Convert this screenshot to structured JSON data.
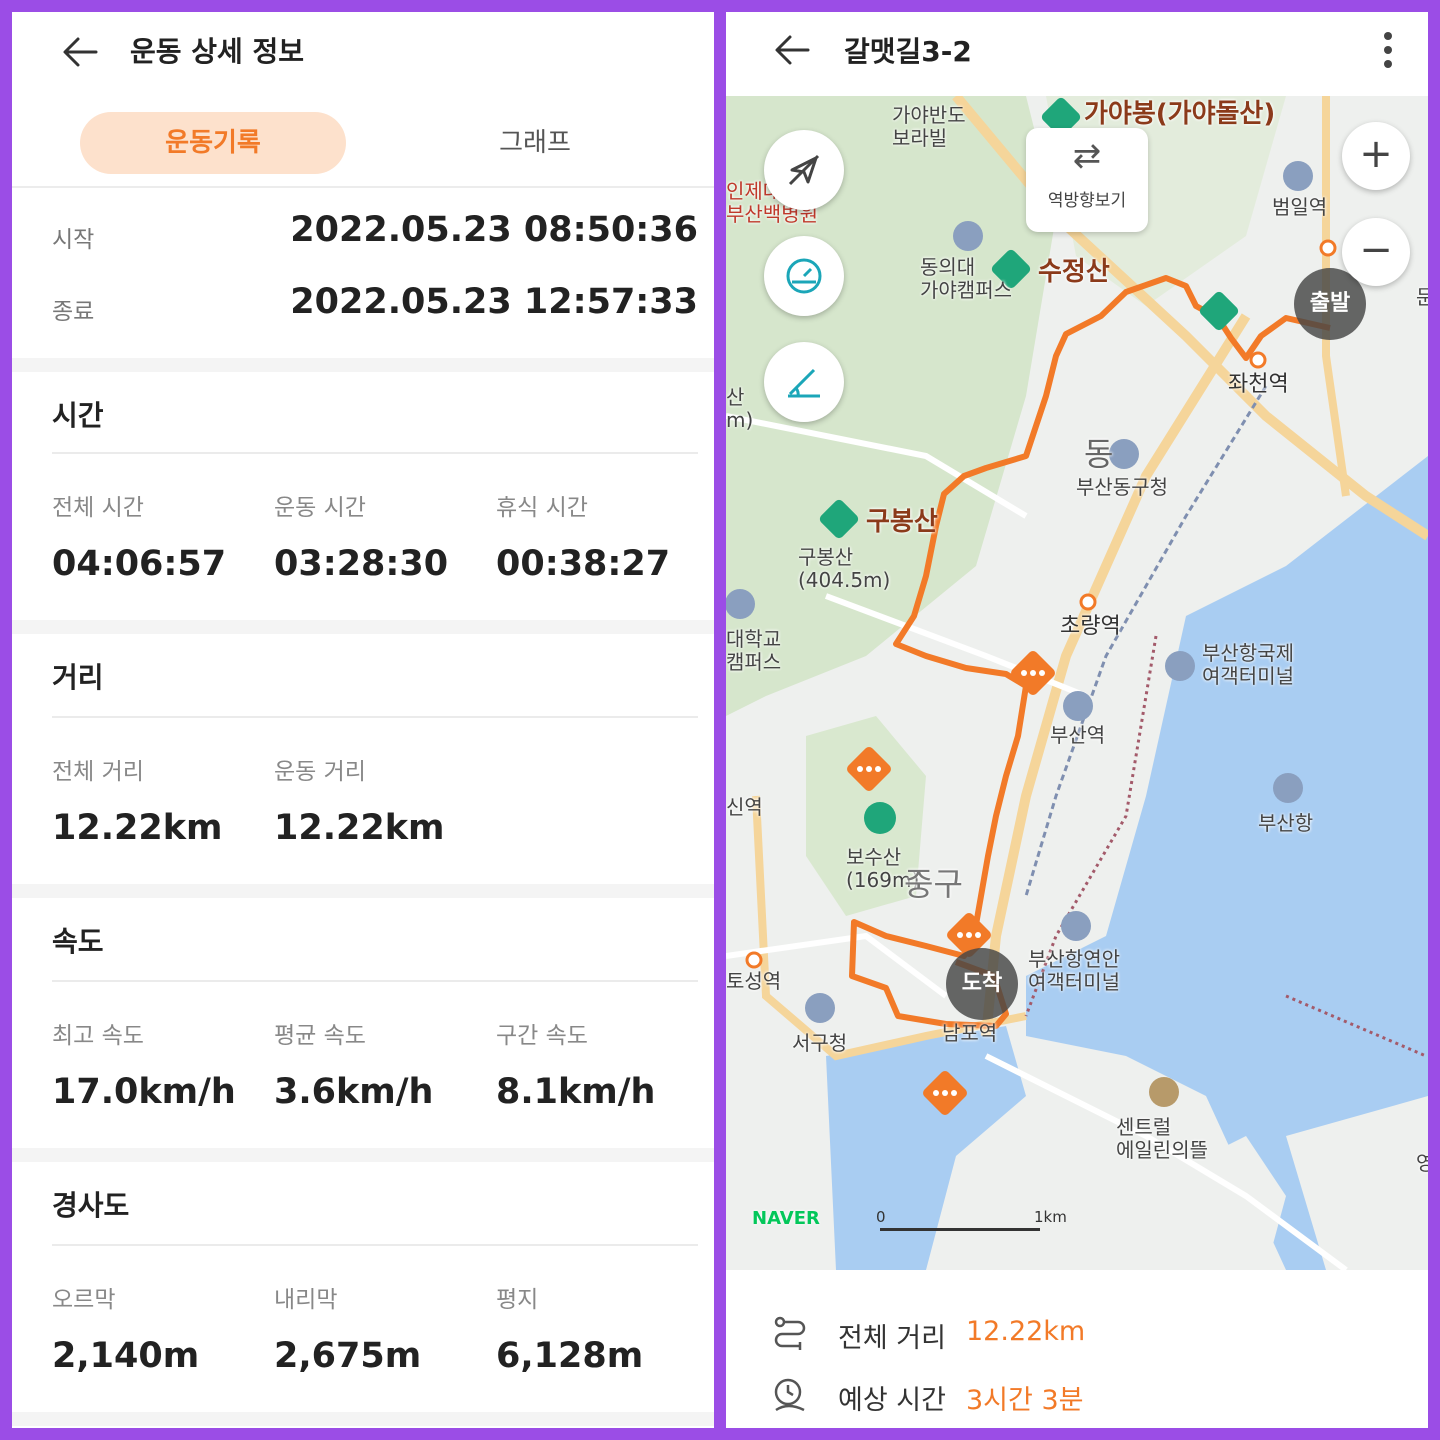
{
  "left": {
    "header_title": "운동 상세 정보",
    "tabs": [
      {
        "label": "운동기록",
        "active": true
      },
      {
        "label": "그래프",
        "active": false
      }
    ],
    "start": {
      "label": "시작",
      "value": "2022.05.23 08:50:36"
    },
    "end": {
      "label": "종료",
      "value": "2022.05.23 12:57:33"
    },
    "sections": [
      {
        "title": "시간",
        "items": [
          {
            "label": "전체 시간",
            "value": "04:06:57"
          },
          {
            "label": "운동 시간",
            "value": "03:28:30"
          },
          {
            "label": "휴식 시간",
            "value": "00:38:27"
          }
        ]
      },
      {
        "title": "거리",
        "items": [
          {
            "label": "전체 거리",
            "value": "12.22km"
          },
          {
            "label": "운동 거리",
            "value": "12.22km"
          }
        ]
      },
      {
        "title": "속도",
        "items": [
          {
            "label": "최고 속도",
            "value": "17.0km/h"
          },
          {
            "label": "평균 속도",
            "value": "3.6km/h"
          },
          {
            "label": "구간 속도",
            "value": "8.1km/h"
          }
        ]
      },
      {
        "title": "경사도",
        "items": [
          {
            "label": "오르막",
            "value": "2,140m"
          },
          {
            "label": "내리막",
            "value": "2,675m"
          },
          {
            "label": "평지",
            "value": "6,128m"
          }
        ]
      }
    ]
  },
  "right": {
    "title": "갈맷길3-2",
    "reverse_label": "역방향보기",
    "zoom_in": "+",
    "zoom_out": "−",
    "start_pin": "출발",
    "end_pin": "도착",
    "map_labels": {
      "gayabando": "가야반도\n보라빌",
      "gayabong": "가야봉(가야돌산)",
      "inje": "인제대\n부산백병원",
      "beomilyeok": "범일역",
      "dongeui": "동의대\n가야캠퍼스",
      "sujeongsan": "수정산",
      "jwacheon": "좌천역",
      "dong": "동",
      "busandonggu": "부산동구청",
      "gubongsan_big": "구봉산",
      "gubongsan": "구봉산\n(404.5m)",
      "univ": "대학교\n캠퍼스",
      "choryang": "초량역",
      "intl_terminal": "부산항국제\n여객터미널",
      "busanyeok": "부산역",
      "sinyeok": "신역",
      "busanhang": "부산항",
      "bosusan": "보수산\n(169m)",
      "junggu": "중구",
      "toseong": "토성역",
      "coastal_terminal": "부산항연안\n여객터미널",
      "seogu": "서구청",
      "nampo": "남포역",
      "central": "센트럴\n에일린의뜰",
      "edge_m": "산\nm)",
      "edge_mun": "문",
      "edge_yeong": "영",
      "beomil_partial": "범일역"
    },
    "naver": "NAVER",
    "scale_0": "0",
    "scale_1": "1km",
    "total_distance": {
      "label": "전체 거리",
      "value": "12.22km"
    },
    "est_time": {
      "label": "예상 시간",
      "value": "3시간 3분"
    }
  },
  "colors": {
    "accent": "#f27a28",
    "frame": "#9b4de6",
    "route": "#f27a28",
    "water": "#a9cdf2",
    "green": "#cfe3c4"
  }
}
